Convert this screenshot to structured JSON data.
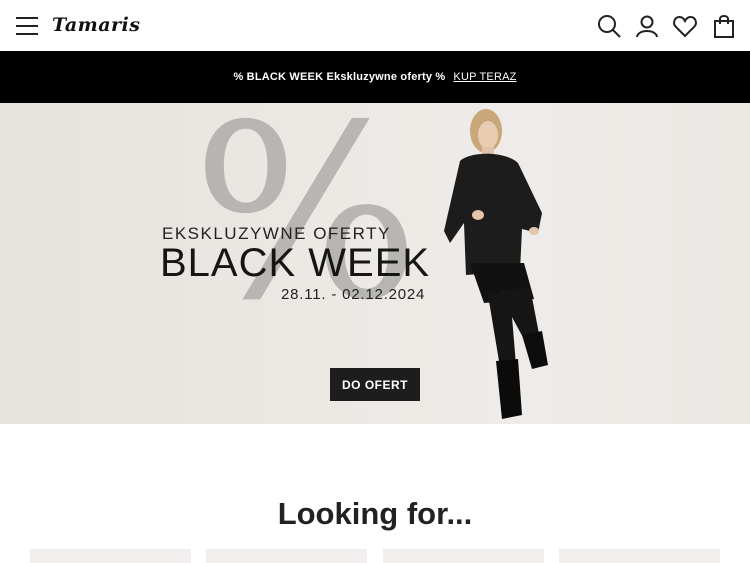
{
  "header": {
    "logo": "Tamaris",
    "icons": [
      "menu-icon",
      "search-icon",
      "account-icon",
      "heart-icon",
      "bag-icon"
    ]
  },
  "promo": {
    "text": "% BLACK WEEK Ekskluzywne oferty %",
    "link": "KUP TERAZ"
  },
  "hero": {
    "eyebrow": "EKSKLUZYWNE OFERTY",
    "title": "BLACK WEEK",
    "dates": "28.11. - 02.12.2024",
    "cta": "DO OFERT"
  },
  "section": {
    "title": "Looking for..."
  },
  "colors": {
    "promo_bg": "#000000",
    "hero_bg": "#ebe8e4",
    "cta_bg": "#1d1d1d"
  }
}
